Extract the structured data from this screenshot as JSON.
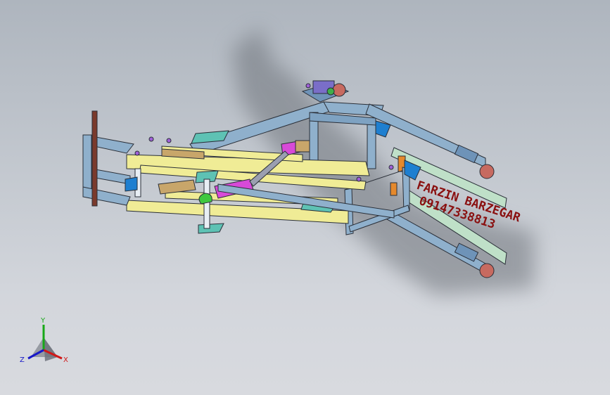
{
  "viewport": {
    "background_top": "#aeb5be",
    "background_bottom": "#d8dadf"
  },
  "model": {
    "watermark_name": "FARZIN BARZEGAR",
    "watermark_phone": "09147338813"
  },
  "triad": {
    "y_label": "Y",
    "x_label": "X",
    "z_label": "Z",
    "y_color": "#18a818",
    "x_color": "#d01818",
    "z_color": "#1818c8"
  }
}
